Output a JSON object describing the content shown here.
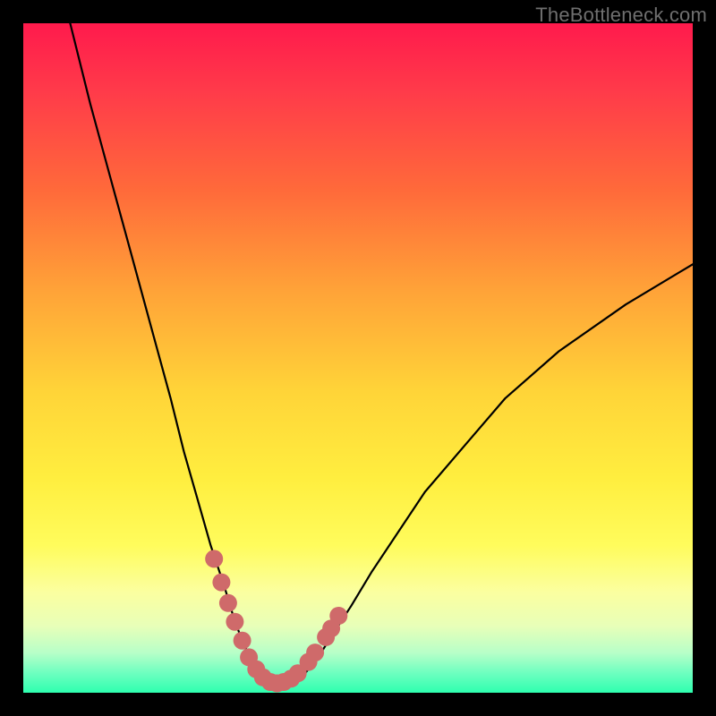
{
  "watermark": "TheBottleneck.com",
  "colors": {
    "frame_bg": "#000000",
    "curve": "#000000",
    "marker": "#cf6a6a",
    "gradient_stops": [
      "#ff1a4c",
      "#ff3a4a",
      "#ff6a3a",
      "#ffa338",
      "#ffd438",
      "#ffee3f",
      "#fffc5c",
      "#fbffa0",
      "#e8ffb8",
      "#b8ffc8",
      "#6fffc0",
      "#2effaf"
    ]
  },
  "chart_data": {
    "type": "line",
    "title": "",
    "xlabel": "",
    "ylabel": "",
    "x_range": [
      0,
      100
    ],
    "y_range": [
      0,
      100
    ],
    "ylim": [
      0,
      100
    ],
    "series": [
      {
        "name": "bottleneck-curve",
        "x": [
          7,
          10,
          13,
          16,
          19,
          22,
          24,
          26,
          28,
          30,
          31.5,
          33,
          34.5,
          36,
          37.5,
          39,
          40.5,
          42,
          44,
          46,
          49,
          52,
          56,
          60,
          66,
          72,
          80,
          90,
          100
        ],
        "y": [
          100,
          88,
          77,
          66,
          55,
          44,
          36,
          29,
          22,
          16,
          11,
          7,
          4.5,
          2.8,
          1.8,
          1.4,
          1.8,
          2.8,
          5.2,
          8.4,
          13,
          18,
          24,
          30,
          37,
          44,
          51,
          58,
          64
        ]
      }
    ],
    "markers": {
      "name": "highlighted-points",
      "points": [
        {
          "x": 28.5,
          "y": 20
        },
        {
          "x": 29.6,
          "y": 16.5
        },
        {
          "x": 30.6,
          "y": 13.4
        },
        {
          "x": 31.6,
          "y": 10.6
        },
        {
          "x": 32.7,
          "y": 7.8
        },
        {
          "x": 33.7,
          "y": 5.3
        },
        {
          "x": 34.8,
          "y": 3.5
        },
        {
          "x": 35.8,
          "y": 2.3
        },
        {
          "x": 36.9,
          "y": 1.6
        },
        {
          "x": 37.9,
          "y": 1.4
        },
        {
          "x": 38.9,
          "y": 1.6
        },
        {
          "x": 40.0,
          "y": 2.1
        },
        {
          "x": 41.0,
          "y": 2.9
        },
        {
          "x": 42.6,
          "y": 4.6
        },
        {
          "x": 43.6,
          "y": 6.0
        },
        {
          "x": 45.2,
          "y": 8.3
        },
        {
          "x": 46.0,
          "y": 9.6
        },
        {
          "x": 47.1,
          "y": 11.5
        }
      ]
    }
  }
}
